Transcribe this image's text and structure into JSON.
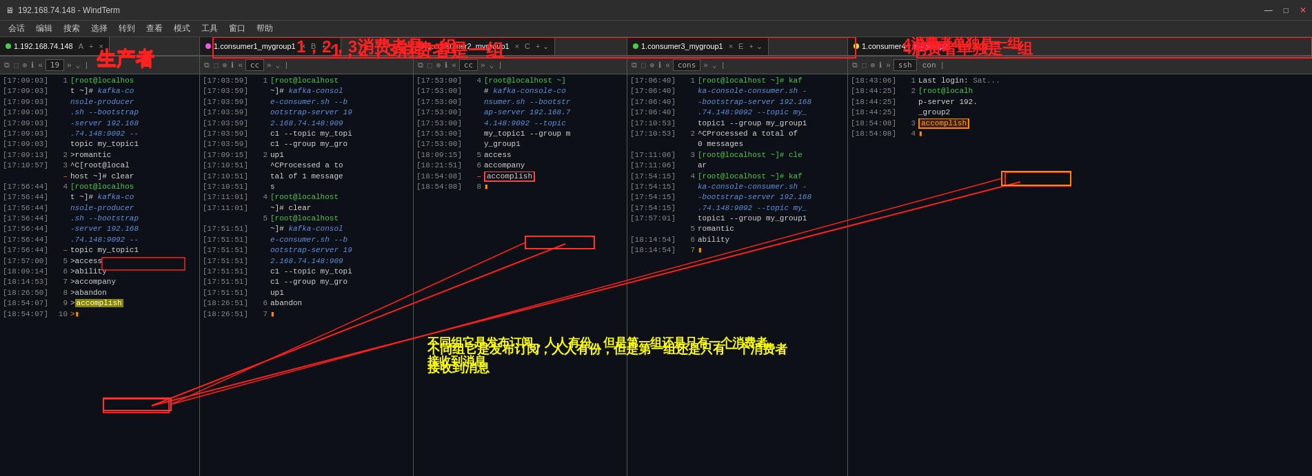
{
  "titlebar": {
    "title": "192.168.74.148 - WindTerm",
    "minimize": "—",
    "maximize": "□",
    "close": "✕"
  },
  "menubar": {
    "items": [
      "会话",
      "编辑",
      "搜索",
      "选择",
      "转到",
      "查看",
      "模式",
      "工具",
      "窗口",
      "帮助"
    ]
  },
  "annotations": {
    "top_label": "1，2，3消费者是一组",
    "right_label": "4消费者单独是一组",
    "producer_label": "生产者",
    "bottom_note": "不同组它是发布订阅，人人有份，但是第一组还是只有一个消费者\n接收到消息"
  },
  "panels": {
    "producer": {
      "tab_label": "1.192.168.74.148",
      "tab_letter": "A",
      "cmd": "19",
      "lines": [
        {
          "time": "[17:09:03]",
          "num": "1",
          "content": "[root@localhos",
          "class": "green"
        },
        {
          "time": "[17:09:03]",
          "num": "",
          "content": "t ~]# kafka-co",
          "class": ""
        },
        {
          "time": "[17:09:03]",
          "num": "",
          "content": "nsole-producer",
          "class": ""
        },
        {
          "time": "[17:09:03]",
          "num": "",
          "content": ".sh --bootstrap",
          "class": "blue-cmd"
        },
        {
          "time": "[17:09:03]",
          "num": "",
          "content": "-server 192.168",
          "class": "blue-cmd"
        },
        {
          "time": "[17:09:03]",
          "num": "",
          "content": ".74.148:9092 --",
          "class": "blue-cmd"
        },
        {
          "time": "[17:09:03]",
          "num": "",
          "content": "topic my_topic1",
          "class": ""
        },
        {
          "time": "[17:09:13]",
          "num": "2",
          "content": ">romantic",
          "class": ""
        },
        {
          "time": "[17:10:57]",
          "num": "3",
          "content": "^C[root@local",
          "class": ""
        },
        {
          "time": "",
          "num": "",
          "content": "host ~]# clear",
          "class": ""
        },
        {
          "time": "[17:56:44]",
          "num": "4",
          "content": "[root@localhos",
          "class": "green"
        },
        {
          "time": "[17:56:44]",
          "num": "",
          "content": "t ~]# kafka-co",
          "class": ""
        },
        {
          "time": "[17:56:44]",
          "num": "",
          "content": "nsole-producer",
          "class": ""
        },
        {
          "time": "[17:56:44]",
          "num": "",
          "content": ".sh --bootstrap",
          "class": "blue-cmd"
        },
        {
          "time": "[17:56:44]",
          "num": "",
          "content": "-server 192.168",
          "class": "blue-cmd"
        },
        {
          "time": "[17:56:44]",
          "num": "",
          "content": ".74.148:9092 --",
          "class": "blue-cmd"
        },
        {
          "time": "[17:56:44]",
          "num": "",
          "content": "topic my_topic1",
          "class": ""
        },
        {
          "time": "[17:57:00]",
          "num": "5",
          "content": ">access",
          "class": ""
        },
        {
          "time": "[18:09:14]",
          "num": "6",
          "content": ">ability",
          "class": ""
        },
        {
          "time": "[18:14:53]",
          "num": "7",
          "content": ">accompany",
          "class": ""
        },
        {
          "time": "[18:26:50]",
          "num": "8",
          "content": ">abandon",
          "class": ""
        },
        {
          "time": "[18:54:07]",
          "num": "9",
          "content": ">accomplish",
          "class": "highlight-yellow"
        },
        {
          "time": "[18:54:07]",
          "num": "10",
          "content": ">",
          "class": ""
        }
      ]
    },
    "c1": {
      "tab_label": "1.consumer1_mygroup1",
      "tab_letter": "B",
      "cmd": "cc",
      "lines": [
        {
          "time": "[17:03:59]",
          "num": "1",
          "content": "[root@localhost",
          "class": "green"
        },
        {
          "time": "[17:03:59]",
          "num": "",
          "content": "~]# kafka-consol",
          "class": ""
        },
        {
          "time": "[17:03:59]",
          "num": "",
          "content": "e-consumer.sh --b",
          "class": "blue-cmd"
        },
        {
          "time": "[17:03:59]",
          "num": "",
          "content": "ootstrap-server 19",
          "class": "blue-cmd"
        },
        {
          "time": "[17:03:59]",
          "num": "",
          "content": "2.168.74.148:909",
          "class": "blue-cmd"
        },
        {
          "time": "[17:03:59]",
          "num": "",
          "content": "c1 --topic my_topi",
          "class": ""
        },
        {
          "time": "[17:03:59]",
          "num": "",
          "content": "c1 --group my_gro",
          "class": ""
        },
        {
          "time": "[17:09:15]",
          "num": "2",
          "content": "up1",
          "class": ""
        },
        {
          "time": "[17:10:51]",
          "num": "",
          "content": "^CProcessed a to",
          "class": ""
        },
        {
          "time": "[17:10:51]",
          "num": "",
          "content": "tal of 1 message",
          "class": ""
        },
        {
          "time": "[17:10:51]",
          "num": "",
          "content": "s",
          "class": ""
        },
        {
          "time": "[17:11:01]",
          "num": "4",
          "content": "[root@localhost",
          "class": "green"
        },
        {
          "time": "[17:11:01]",
          "num": "",
          "content": "~]# clear",
          "class": ""
        },
        {
          "time": "",
          "num": "5",
          "content": "[root@localhost",
          "class": "green"
        },
        {
          "time": "[17:51:51]",
          "num": "",
          "content": "~]# kafka-consol",
          "class": ""
        },
        {
          "time": "[17:51:51]",
          "num": "",
          "content": "e-consumer.sh --b",
          "class": "blue-cmd"
        },
        {
          "time": "[17:51:51]",
          "num": "",
          "content": "ootstrap-server 19",
          "class": "blue-cmd"
        },
        {
          "time": "[17:51:51]",
          "num": "",
          "content": "2.168.74.148:909",
          "class": "blue-cmd"
        },
        {
          "time": "[17:51:51]",
          "num": "",
          "content": "c1 --topic my_topi",
          "class": ""
        },
        {
          "time": "[17:51:51]",
          "num": "",
          "content": "c1 --group my_gro",
          "class": ""
        },
        {
          "time": "[17:51:51]",
          "num": "",
          "content": "up1",
          "class": ""
        },
        {
          "time": "[18:26:51]",
          "num": "6",
          "content": "abandon",
          "class": ""
        },
        {
          "time": "[18:26:51]",
          "num": "7",
          "content": "",
          "class": ""
        }
      ]
    },
    "c2": {
      "tab_label": "1.consumer2_mygroup1",
      "tab_letter": "C",
      "cmd": "cc",
      "lines": [
        {
          "time": "[17:53:00]",
          "num": "4",
          "content": "[root@localhost ~]",
          "class": "green"
        },
        {
          "time": "[17:53:00]",
          "num": "",
          "content": "# kafka-console-co",
          "class": ""
        },
        {
          "time": "[17:53:00]",
          "num": "",
          "content": "nsumer.sh --bootstr",
          "class": "blue-cmd"
        },
        {
          "time": "[17:53:00]",
          "num": "",
          "content": "ap-server 192.168.7",
          "class": "blue-cmd"
        },
        {
          "time": "[17:53:00]",
          "num": "",
          "content": "4.148:9092 --topic",
          "class": "blue-cmd"
        },
        {
          "time": "[17:53:00]",
          "num": "",
          "content": "my_topic1 --group m",
          "class": ""
        },
        {
          "time": "[17:53:00]",
          "num": "",
          "content": "y_group1",
          "class": ""
        },
        {
          "time": "[18:09:15]",
          "num": "5",
          "content": "access",
          "class": ""
        },
        {
          "time": "[18:21:51]",
          "num": "6",
          "content": "accompany",
          "class": ""
        },
        {
          "time": "[18:54:08]",
          "num": "7",
          "content": "accomplish",
          "class": "highlight-red"
        },
        {
          "time": "[18:54:08]",
          "num": "8",
          "content": "",
          "class": ""
        }
      ]
    },
    "c3": {
      "tab_label": "1.consumer3_mygroup1",
      "tab_letter": "E",
      "cmd": "cons",
      "lines": [
        {
          "time": "[17:06:40]",
          "num": "1",
          "content": "[root@localhost ~]# kaf",
          "class": "green"
        },
        {
          "time": "[17:06:40]",
          "num": "",
          "content": "ka-console-consumer.sh -",
          "class": ""
        },
        {
          "time": "[17:06:40]",
          "num": "",
          "content": "-bootstrap-server 192.168",
          "class": "blue-cmd"
        },
        {
          "time": "[17:06:40]",
          "num": "",
          "content": ".74.148:9092 --topic my_",
          "class": "blue-cmd"
        },
        {
          "time": "[17:10:53]",
          "num": "",
          "content": "topic1 --group my_group1",
          "class": ""
        },
        {
          "time": "[17:10:53]",
          "num": "2",
          "content": "^CProcessed a total of",
          "class": ""
        },
        {
          "time": "",
          "num": "",
          "content": "0 messages",
          "class": ""
        },
        {
          "time": "[17:11:06]",
          "num": "3",
          "content": "[root@localhost ~]# cle",
          "class": "green"
        },
        {
          "time": "[17:11:06]",
          "num": "",
          "content": "ar",
          "class": ""
        },
        {
          "time": "[17:54:15]",
          "num": "4",
          "content": "[root@localhost ~]# kaf",
          "class": "green"
        },
        {
          "time": "[17:54:15]",
          "num": "",
          "content": "ka-console-consumer.sh -",
          "class": ""
        },
        {
          "time": "[17:54:15]",
          "num": "",
          "content": "-bootstrap-server 192.168",
          "class": "blue-cmd"
        },
        {
          "time": "[17:54:15]",
          "num": "",
          "content": ".74.148:9092 --topic my_",
          "class": "blue-cmd"
        },
        {
          "time": "[17:57:01]",
          "num": "",
          "content": "topic1 --group my_group1",
          "class": ""
        },
        {
          "time": "",
          "num": "5",
          "content": "romantic",
          "class": ""
        },
        {
          "time": "[18:14:54]",
          "num": "6",
          "content": "ability",
          "class": ""
        },
        {
          "time": "[18:14:54]",
          "num": "7",
          "content": "",
          "class": ""
        }
      ]
    },
    "c4": {
      "tab_label": "1.consumer4_mygroup2",
      "tab_letter": "",
      "cmd": "con",
      "lines": [
        {
          "time": "[18:43:06]",
          "num": "1",
          "content": "Last login:",
          "class": ""
        },
        {
          "time": "[18:44:25]",
          "num": "2",
          "content": "[root@localh",
          "class": "green"
        },
        {
          "time": "[18:44:25]",
          "num": "",
          "content": "p-server 192.",
          "class": ""
        },
        {
          "time": "[18:44:25]",
          "num": "",
          "content": "_group2",
          "class": ""
        },
        {
          "time": "[18:54:08]",
          "num": "3",
          "content": "accomplish",
          "class": "highlight-orange"
        },
        {
          "time": "[18:54:08]",
          "num": "4",
          "content": "",
          "class": ""
        }
      ]
    }
  }
}
